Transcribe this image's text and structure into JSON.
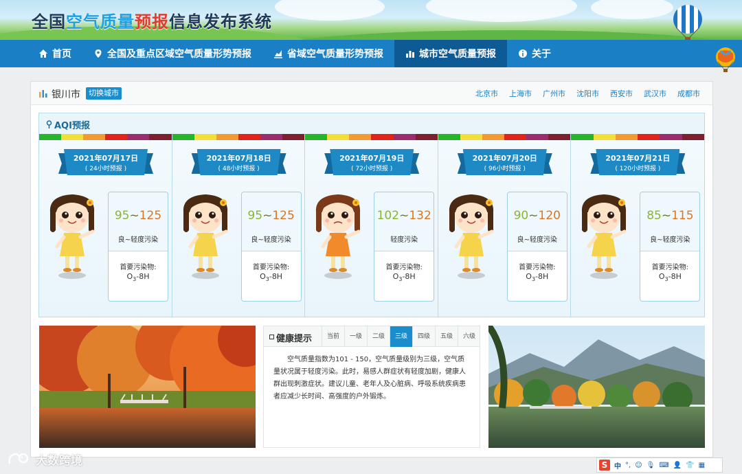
{
  "header": {
    "title_parts": [
      "全国",
      "空气质量",
      "预报",
      "信息发布系统"
    ]
  },
  "nav": {
    "items": [
      {
        "label": "首页",
        "icon": "home-icon"
      },
      {
        "label": "全国及重点区域空气质量形势预报",
        "icon": "location-pin-icon"
      },
      {
        "label": "省域空气质量形势预报",
        "icon": "chart-icon"
      },
      {
        "label": "城市空气质量预报",
        "icon": "bar-chart-icon",
        "active": true
      },
      {
        "label": "关于",
        "icon": "info-icon"
      }
    ]
  },
  "city": {
    "current": "银川市",
    "switch_label": "切换城市",
    "links": [
      "北京市",
      "上海市",
      "广州市",
      "沈阳市",
      "西安市",
      "武汉市",
      "成都市"
    ]
  },
  "aqi": {
    "title": "AQI预报",
    "level_colors": [
      "#25b52a",
      "#f2e03a",
      "#f39a33",
      "#e2231a",
      "#9b2d6e",
      "#7e1f2e"
    ],
    "days": [
      {
        "date": "2021年07月17日",
        "horizon": "( 24小时预报 )",
        "low": "95",
        "high": "125",
        "level": "良~轻度污染",
        "pollutant_label": "首要污染物:",
        "pollutant": "O3-8H",
        "mood": "happy"
      },
      {
        "date": "2021年07月18日",
        "horizon": "( 48小时预报 )",
        "low": "95",
        "high": "125",
        "level": "良~轻度污染",
        "pollutant_label": "首要污染物:",
        "pollutant": "O3-8H",
        "mood": "happy"
      },
      {
        "date": "2021年07月19日",
        "horizon": "( 72小时预报 )",
        "low": "102",
        "high": "132",
        "level": "轻度污染",
        "pollutant_label": "首要污染物:",
        "pollutant": "O3-8H",
        "mood": "sad"
      },
      {
        "date": "2021年07月20日",
        "horizon": "( 96小时预报 )",
        "low": "90",
        "high": "120",
        "level": "良~轻度污染",
        "pollutant_label": "首要污染物:",
        "pollutant": "O3-8H",
        "mood": "happy"
      },
      {
        "date": "2021年07月21日",
        "horizon": "( 120小时预报 )",
        "low": "85",
        "high": "115",
        "level": "良~轻度污染",
        "pollutant_label": "首要污染物:",
        "pollutant": "O3-8H",
        "mood": "happy"
      }
    ]
  },
  "health": {
    "title": "健康提示",
    "tabs": [
      "当前",
      "一级",
      "二级",
      "三级",
      "四级",
      "五级",
      "六级"
    ],
    "active_tab": "三级",
    "text": "空气质量指数为101 - 150，空气质量级别为三级，空气质量状况属于轻度污染。此时，易感人群症状有轻度加剧，健康人群出现刺激症状。建议儿童、老年人及心脏病、呼吸系统疾病患者应减少长时间、高强度的户外锻炼。"
  },
  "watermark": {
    "text": "大数跨境"
  },
  "ime": {
    "mode": "中"
  }
}
